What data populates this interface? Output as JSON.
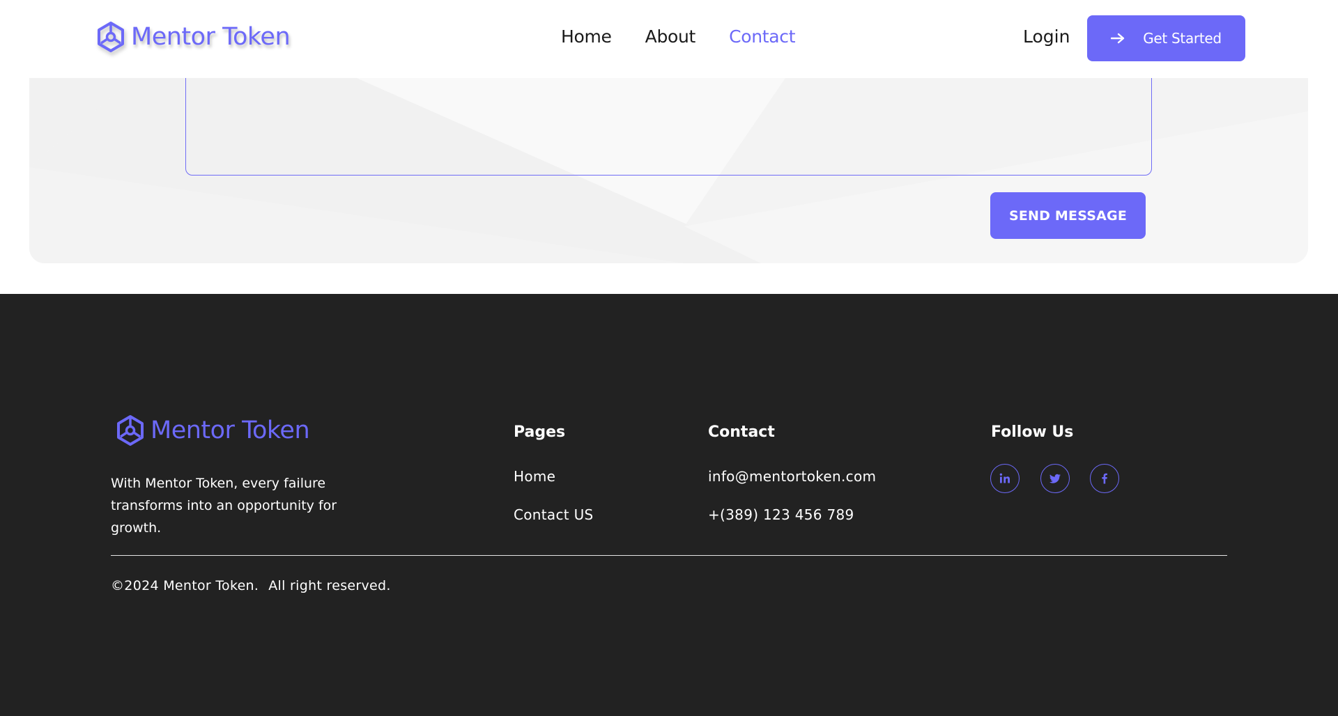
{
  "header": {
    "brand_name": "Mentor Token",
    "nav": [
      {
        "label": "Home",
        "active": false
      },
      {
        "label": "About",
        "active": false
      },
      {
        "label": "Contact",
        "active": true
      }
    ],
    "login_label": "Login",
    "get_started_label": "Get Started"
  },
  "contact_form": {
    "message_value": "",
    "send_label": "SEND MESSAGE"
  },
  "footer": {
    "brand_name": "Mentor Token",
    "tagline": "With Mentor Token, every failure transforms into an opportunity for growth.",
    "pages": {
      "title": "Pages",
      "links": [
        "Home",
        "Contact US"
      ]
    },
    "contact": {
      "title": "Contact",
      "email": "info@mentortoken.com",
      "phone": "+(389) 123 456 789"
    },
    "follow": {
      "title": "Follow Us",
      "icons": [
        "linkedin-icon",
        "twitter-icon",
        "facebook-icon"
      ]
    },
    "copyright": "©2024 Mentor Token.",
    "rights": "All right reserved."
  },
  "colors": {
    "accent": "#6c69f8",
    "footer_bg": "#222222",
    "section_bg": "#f7f7f7"
  }
}
